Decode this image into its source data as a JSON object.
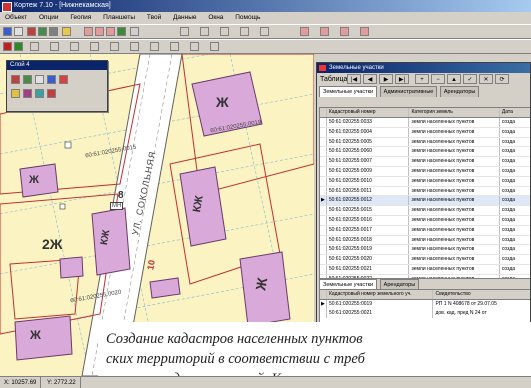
{
  "window": {
    "title": "Кортеж 7.10 - [Нижнекамская]"
  },
  "menu": [
    "Объект",
    "Опции",
    "Геопия",
    "Планшеты",
    "Твой",
    "Данные",
    "Окна",
    "Помощь"
  ],
  "palette": {
    "title": "Слой 4"
  },
  "map": {
    "street": "УЛ. СОКОЛЬНЯЯ",
    "labels": {
      "zh1": "Ж",
      "zh2": "Ж",
      "zh3": "Ж",
      "zh4": "Ж",
      "kzh1": "КЖ",
      "kzh2": "КЖ",
      "two_zh": "2Ж",
      "mn": "МН",
      "eight": "8",
      "ten": "10"
    },
    "parcels": [
      "60:61:020255:0019",
      "60:61:020255:0015",
      "60:61:020255:0020"
    ]
  },
  "browser": {
    "title": "Земельные участки",
    "nav_label": "Таблица",
    "nav_buttons": [
      "|◀",
      "◀",
      "▶",
      "▶|",
      "+",
      "−",
      "▲",
      "✓",
      "✕",
      "⟳"
    ],
    "tabs": [
      "Земельные участки",
      "Административные",
      "Арендаторы"
    ],
    "columns": [
      "Кадастровый номер",
      "Категория земель",
      "Дата"
    ],
    "rows": [
      {
        "num": "50:61:020255:0033",
        "cat": "земли населенных пунктов",
        "d": "созда"
      },
      {
        "num": "50:61:020255:0004",
        "cat": "земли населенных пунктов",
        "d": "созда"
      },
      {
        "num": "50:61:020255:0005",
        "cat": "земли населенных пунктов",
        "d": "созда"
      },
      {
        "num": "50:61:020255:0060",
        "cat": "земли населенных пунктов",
        "d": "созда"
      },
      {
        "num": "50:61:020255:0007",
        "cat": "земли населенных пунктов",
        "d": "созда"
      },
      {
        "num": "50:61:020255:0009",
        "cat": "земли населенных пунктов",
        "d": "созда"
      },
      {
        "num": "50:61:020255:0010",
        "cat": "земли населенных пунктов",
        "d": "созда"
      },
      {
        "num": "50:61:020255:0011",
        "cat": "земли населенных пунктов",
        "d": "созда"
      },
      {
        "num": "50:61:020255:0012",
        "cat": "земли населенных пунктов",
        "d": "созда"
      },
      {
        "num": "50:61:020255:0015",
        "cat": "земли населенных пунктов",
        "d": "созда"
      },
      {
        "num": "50:61:020255:0016",
        "cat": "земли населенных пунктов",
        "d": "созда"
      },
      {
        "num": "50:61:020255:0017",
        "cat": "земли населенных пунктов",
        "d": "созда"
      },
      {
        "num": "50:61:020255:0018",
        "cat": "земли населенных пунктов",
        "d": "созда"
      },
      {
        "num": "50:61:020255:0019",
        "cat": "земли населенных пунктов",
        "d": "созда"
      },
      {
        "num": "50:61:020255:0020",
        "cat": "земли населенных пунктов",
        "d": "созда"
      },
      {
        "num": "50:61:020255:0021",
        "cat": "земли населенных пунктов",
        "d": "созда"
      },
      {
        "num": "50:61:020255:0022",
        "cat": "земли населенных пунктов",
        "d": "созда"
      },
      {
        "num": "50:61:020255:0023",
        "cat": "земли населенных пунктов",
        "d": "созда"
      }
    ],
    "selected_row": 8,
    "tabs2": [
      "Земельные участки",
      "Арендаторы"
    ],
    "columns2": [
      "Кадастровый номер земельного уч.",
      "Свидетельство"
    ],
    "rows2": [
      {
        "num": "50:61:020255:0019",
        "doc": "РП 1 N 408678 от 29.07.05"
      },
      {
        "num": "50:61:020255:0021",
        "doc": "дов. кад. пред N 24 от"
      }
    ]
  },
  "caption": {
    "line1": "Создание кадастров населенных пунктов",
    "line2": "ских территорий в соответствии с треб",
    "line3": "местных администраций. Конструирован"
  },
  "status": [
    "X: 10257.69",
    "Y: 2772.22"
  ]
}
